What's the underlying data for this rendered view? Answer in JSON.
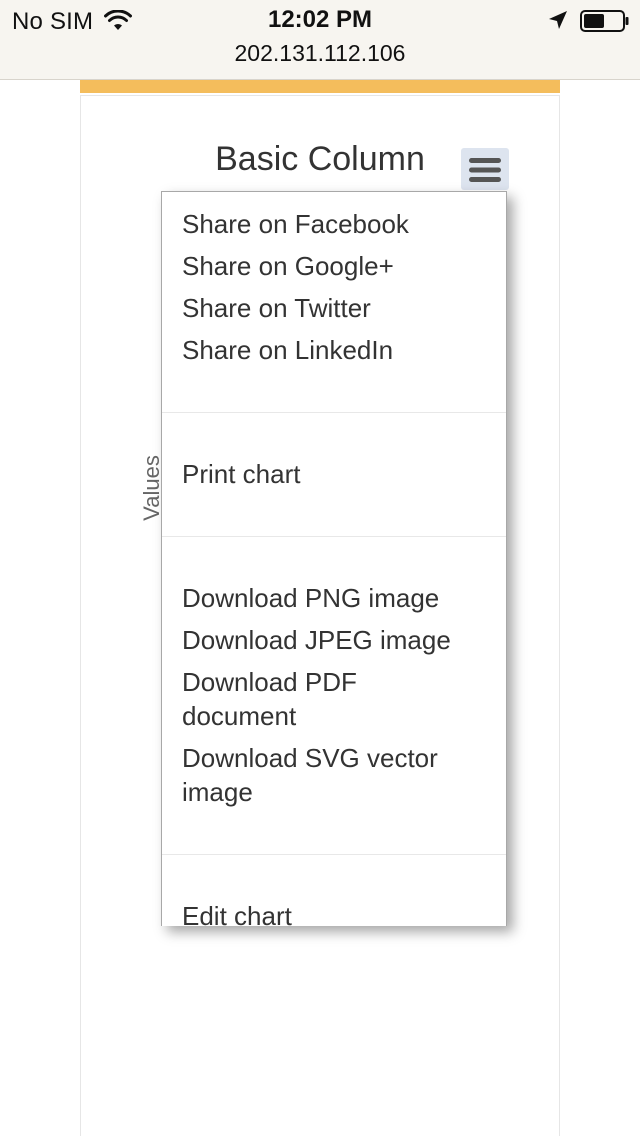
{
  "status_bar": {
    "carrier": "No SIM",
    "time": "12:02 PM",
    "url": "202.131.112.106"
  },
  "icons": {
    "wifi": "wifi-icon",
    "location": "location-arrow-icon",
    "battery": "battery-icon",
    "menu": "hamburger-icon"
  },
  "colors": {
    "accent": "#f4bd5c",
    "menu_button_bg": "#dde4ef"
  },
  "chart": {
    "title": "Basic Column",
    "y_axis_title": "Values"
  },
  "context_menu": {
    "share_facebook": "Share on Facebook",
    "share_google": "Share on Google+",
    "share_twitter": "Share on Twitter",
    "share_linkedin": "Share on LinkedIn",
    "print": "Print chart",
    "download_png": "Download PNG image",
    "download_jpeg": "Download JPEG image",
    "download_pdf": "Download PDF document",
    "download_svg": "Download SVG vector image",
    "edit": "Edit chart"
  }
}
